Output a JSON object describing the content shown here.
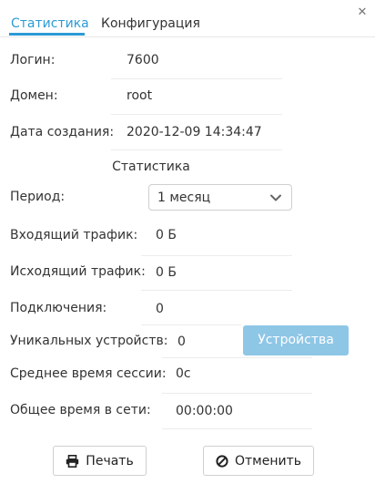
{
  "tabs": [
    {
      "label": "Статистика",
      "active": true
    },
    {
      "label": "Конфигурация",
      "active": false
    }
  ],
  "close_icon": "close-icon",
  "info": [
    {
      "label": "Логин:",
      "value": "7600"
    },
    {
      "label": "Домен:",
      "value": "root"
    },
    {
      "label": "Дата создания:",
      "value": "2020-12-09 14:34:47"
    }
  ],
  "stats": {
    "title": "Статистика",
    "period": {
      "label": "Период:",
      "value": "1 месяц"
    },
    "rows": [
      {
        "label": "Входящий трафик:",
        "value": "0 Б"
      },
      {
        "label": "Исходящий трафик:",
        "value": "0 Б"
      },
      {
        "label": "Подключения:",
        "value": "0"
      },
      {
        "label": "Уникальных устройств:",
        "value": "0"
      },
      {
        "label": "Среднее время сессии:",
        "value": "0с"
      },
      {
        "label": "Общее время в сети:",
        "value": "00:00:00"
      }
    ],
    "devices_button": "Устройства"
  },
  "footer": {
    "print_label": "Печать",
    "print_icon": "printer-icon",
    "cancel_label": "Отменить",
    "cancel_icon": "ban-icon"
  },
  "colors": {
    "accent": "#2c9bd6",
    "devices_button_bg": "#8ec6e6",
    "separator": "#ececec"
  }
}
